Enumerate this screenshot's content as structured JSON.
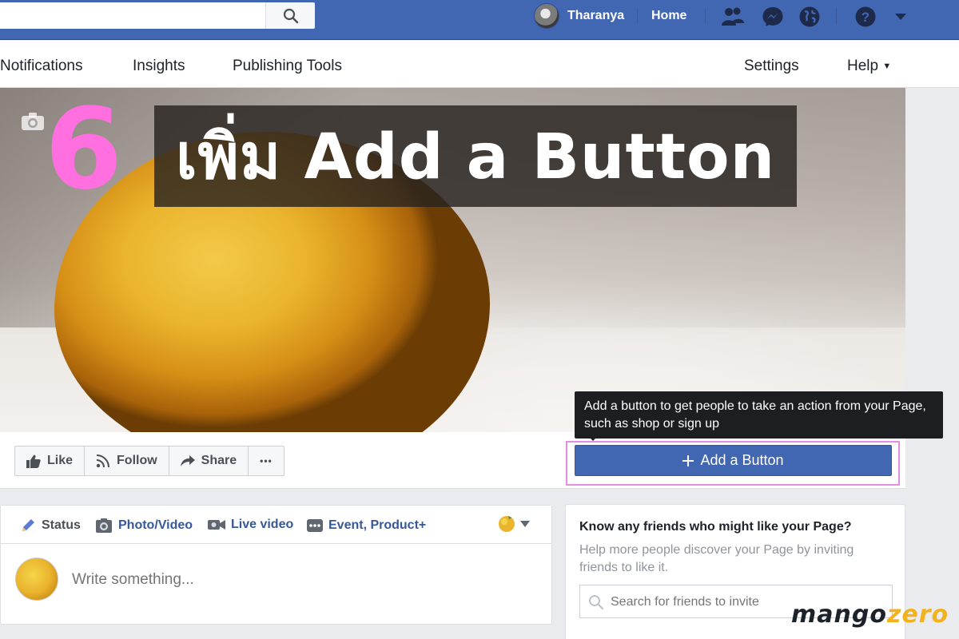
{
  "topbar": {
    "search_placeholder": "",
    "user_name": "Tharanya",
    "home_label": "Home"
  },
  "page_nav": {
    "items": [
      "Notifications",
      "Insights",
      "Publishing Tools",
      "Settings",
      "Help"
    ]
  },
  "cover": {
    "step_number": "6",
    "overlay_title": "เพิ่ม Add a Button"
  },
  "action_bar": {
    "like_label": "Like",
    "follow_label": "Follow",
    "share_label": "Share",
    "more_label": "•••",
    "add_button_label": "Add a Button",
    "tooltip_text": "Add a button to get people to take an action from your Page, such as shop or sign up"
  },
  "composer": {
    "tabs": [
      "Status",
      "Photo/Video",
      "Live video",
      "Event, Product+"
    ],
    "placeholder": "Write something..."
  },
  "invite": {
    "title": "Know any friends who might like your Page?",
    "description": "Help more people discover your Page by inviting friends to like it.",
    "search_placeholder": "Search for friends to invite"
  },
  "watermark": {
    "part1": "mango",
    "part2": "zero"
  },
  "colors": {
    "facebook_blue": "#4267b2",
    "highlight_pink": "#e38ee0",
    "step_number_pink": "#ff6fe0"
  }
}
